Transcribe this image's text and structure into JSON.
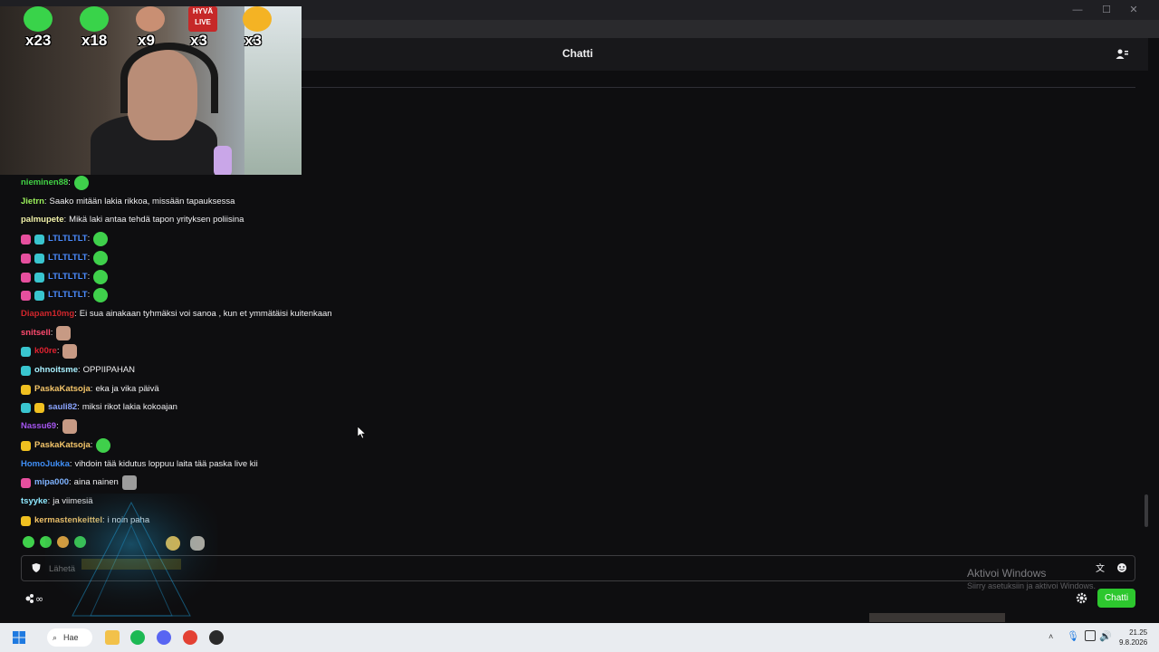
{
  "header": {
    "title": "Chatti"
  },
  "webcam": {
    "badges": [
      {
        "count": "x23",
        "color": "#39d34a"
      },
      {
        "count": "x18",
        "color": "#39d34a"
      },
      {
        "count": "x9",
        "color": "#c98f73"
      },
      {
        "count": "x3",
        "text": "HYVÄ LIVE",
        "color": "#c62828"
      },
      {
        "count": "x3",
        "color": "#f4b324"
      }
    ]
  },
  "messages": [
    {
      "user": "nieminen88",
      "text": "",
      "color": "#42d345",
      "badges": [],
      "emote": "green"
    },
    {
      "user": "Jietrn",
      "text": "Saako mitään lakia rikkoa, missään tapauksessa",
      "color": "#9bf05b",
      "badges": []
    },
    {
      "user": "palmupete",
      "text": "Mikä laki antaa tehdä tapon yrityksen poliisina",
      "color": "#f0f0a8",
      "badges": []
    },
    {
      "user": "LTLTLTLT",
      "text": "",
      "color": "#4b8cff",
      "badges": [
        "#e64f9e",
        "#39c5cf"
      ],
      "emote": "green"
    },
    {
      "user": "LTLTLTLT",
      "text": "",
      "color": "#4b8cff",
      "badges": [
        "#e64f9e",
        "#39c5cf"
      ],
      "emote": "green"
    },
    {
      "user": "LTLTLTLT",
      "text": "",
      "color": "#4b8cff",
      "badges": [
        "#e64f9e",
        "#39c5cf"
      ],
      "emote": "green"
    },
    {
      "user": "LTLTLTLT",
      "text": "",
      "color": "#4b8cff",
      "badges": [
        "#e64f9e",
        "#39c5cf"
      ],
      "emote": "green"
    },
    {
      "user": "Diapam10mg",
      "text": "Ei sua ainakaan tyhmäksi voi sanoa , kun et ymmätäisi kuitenkaan",
      "color": "#d0262c",
      "badges": []
    },
    {
      "user": "snitsell",
      "text": "",
      "color": "#ff4a6e",
      "badges": [],
      "emote": "face"
    },
    {
      "user": "k00re",
      "text": "",
      "color": "#e0212f",
      "badges": [
        "#39c5cf"
      ],
      "emote": "face"
    },
    {
      "user": "ohnoitsme",
      "text": "OPPIIPAHAN",
      "color": "#a8f0ff",
      "badges": [
        "#39c5cf"
      ]
    },
    {
      "user": "PaskaKatsoja",
      "text": "eka ja vika päivä",
      "color": "#f5c66a",
      "badges": [
        "#f0c020"
      ]
    },
    {
      "user": "sauli82",
      "text": "miksi rikot lakia kokoajan",
      "color": "#8aa4ff",
      "badges": [
        "#39c5cf",
        "#f0c020"
      ]
    },
    {
      "user": "Nassu69",
      "text": "",
      "color": "#a555f0",
      "badges": [],
      "emote": "face"
    },
    {
      "user": "PaskaKatsoja",
      "text": "",
      "color": "#f5c66a",
      "badges": [
        "#f0c020"
      ],
      "emote": "green"
    },
    {
      "user": "HomoJukka",
      "text": "vihdoin tää kidutus loppuu laita tää paska live kii",
      "color": "#3f8ef5",
      "badges": []
    },
    {
      "user": "mipa000",
      "text": "aina nainen",
      "color": "#7fb3ff",
      "badges": [
        "#e64f9e"
      ],
      "emote": "gray"
    },
    {
      "user": "tsyyke",
      "text": "ja viimesiä",
      "color": "#8fe9ff",
      "badges": []
    },
    {
      "user": "kermastenkeittel",
      "text": "i noin paha",
      "color": "#f5c66a",
      "badges": [
        "#f0c020"
      ]
    }
  ],
  "input": {
    "placeholder": "Lähetä"
  },
  "buttons": {
    "send_label": "Chatti"
  },
  "windows_watermark": {
    "line1": "Aktivoi Windows",
    "line2": "Siirry asetuksiin ja aktivoi Windows."
  },
  "taskbar": {
    "search_label": "Hae",
    "time": "21.25",
    "date": "9.8.2026"
  },
  "colors": {
    "accent": "#2dc72e",
    "background": "#0e0e10"
  }
}
